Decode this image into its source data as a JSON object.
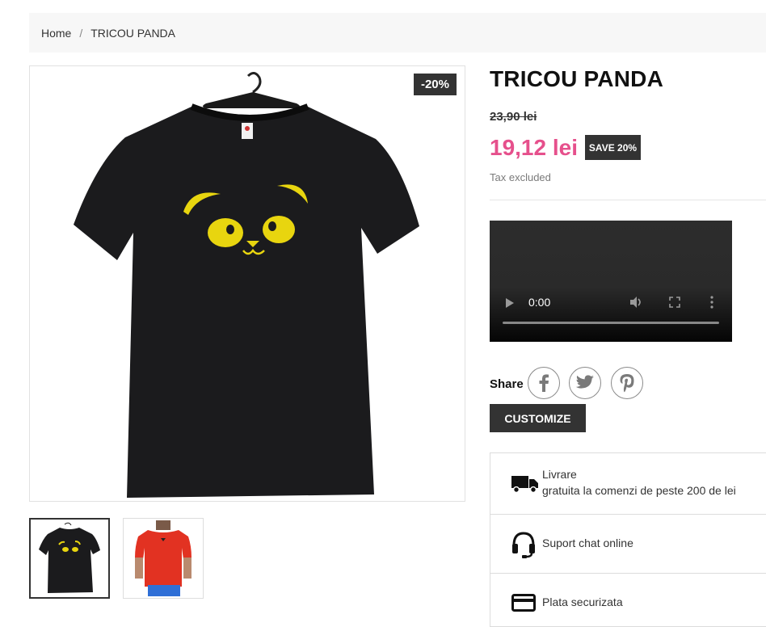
{
  "breadcrumb": {
    "home": "Home",
    "separator": "/",
    "current": "TRICOU PANDA"
  },
  "product": {
    "title": "TRICOU PANDA",
    "discount_flag": "-20%",
    "old_price": "23,90 lei",
    "price": "19,12 lei",
    "save_badge": "SAVE 20%",
    "tax_label": "Tax excluded",
    "price_color": "#e6508c"
  },
  "video": {
    "time": "0:00"
  },
  "share": {
    "label": "Share",
    "networks": [
      "facebook-icon",
      "twitter-icon",
      "pinterest-icon"
    ]
  },
  "customize_label": "CUSTOMIZE",
  "reassurance": [
    {
      "icon": "truck-icon",
      "title": "Livrare",
      "subtitle": "gratuita la comenzi de peste 200 de lei"
    },
    {
      "icon": "headset-icon",
      "title": "Suport chat online"
    },
    {
      "icon": "credit-card-icon",
      "title": "Plata securizata"
    }
  ]
}
